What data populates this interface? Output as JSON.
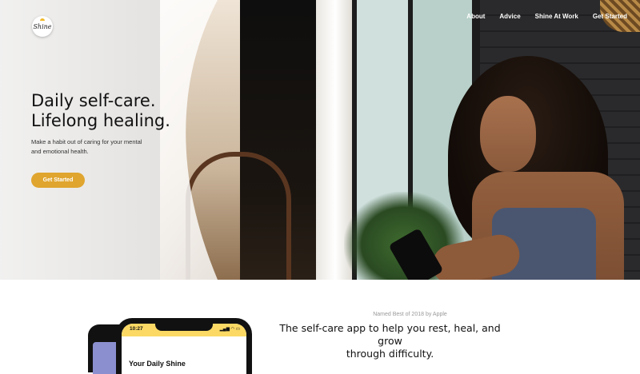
{
  "nav": {
    "logo_text": "Shine",
    "links": [
      "About",
      "Advice",
      "Shine At Work",
      "Get Started"
    ]
  },
  "hero": {
    "headline_line1": "Daily self-care.",
    "headline_line2": "Lifelong healing.",
    "subtext_line1": "Make a habit out of caring for your mental",
    "subtext_line2": "and emotional health.",
    "cta_label": "Get Started"
  },
  "section": {
    "award": "Named Best of 2018 by Apple",
    "tagline_line1": "The self-care app to help you rest, heal, and grow",
    "tagline_line2": "through difficulty."
  },
  "phone": {
    "time": "10:27",
    "status_icons": "▂▄▆ ◠ ▭",
    "screen_title": "Your Daily Shine"
  },
  "colors": {
    "accent": "#e0a52f",
    "phone_header": "#fbd964"
  }
}
